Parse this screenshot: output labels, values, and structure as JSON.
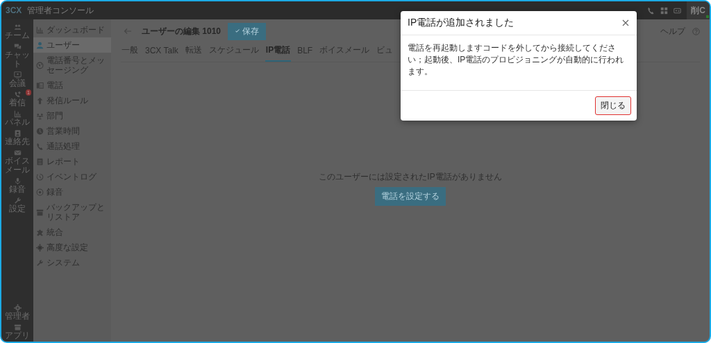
{
  "top_bar": {
    "logo": "3CX",
    "title": "管理者コンソール",
    "avatar": {
      "initials": "削C",
      "online": true
    }
  },
  "rail": {
    "items": [
      {
        "label": "チーム"
      },
      {
        "label": "チャット"
      },
      {
        "label": "会議"
      },
      {
        "label": "着信",
        "badge": "1"
      },
      {
        "label": "パネル"
      },
      {
        "label": "連絡先"
      },
      {
        "label": "ボイスメール"
      },
      {
        "label": "録音"
      },
      {
        "label": "設定"
      }
    ],
    "bottom_items": [
      {
        "label": "管理者"
      },
      {
        "label": "アプリ"
      }
    ]
  },
  "sidebar": {
    "items": [
      {
        "label": "ダッシュボード",
        "selected": false
      },
      {
        "label": "ユーザー",
        "selected": true
      },
      {
        "label": "電話番号とメッセージング",
        "selected": false
      },
      {
        "label": "電話",
        "selected": false
      },
      {
        "label": "発信ルール",
        "selected": false
      },
      {
        "label": "部門",
        "selected": false
      },
      {
        "label": "営業時間",
        "selected": false
      },
      {
        "label": "通話処理",
        "selected": false
      },
      {
        "label": "レポート",
        "selected": false
      },
      {
        "label": "イベントログ",
        "selected": false
      },
      {
        "label": "録音",
        "selected": false
      },
      {
        "label": "バックアップとリストア",
        "selected": false
      },
      {
        "label": "統合",
        "selected": false
      },
      {
        "label": "高度な設定",
        "selected": false
      },
      {
        "label": "システム",
        "selected": false
      }
    ]
  },
  "page": {
    "title": "ユーザーの編集 1010",
    "save_button": "保存",
    "help": "ヘルプ",
    "tabs": [
      {
        "label": "一般",
        "selected": false
      },
      {
        "label": "3CX Talk",
        "selected": false
      },
      {
        "label": "転送",
        "selected": false
      },
      {
        "label": "スケジュール",
        "selected": false
      },
      {
        "label": "IP電話",
        "selected": true
      },
      {
        "label": "BLF",
        "selected": false
      },
      {
        "label": "ボイスメール",
        "selected": false
      },
      {
        "label": "ビュ",
        "selected": false
      }
    ],
    "empty_message": "このユーザーには設定されたIP電話がありません",
    "add_phone_button": "電話を設定する"
  },
  "dialog": {
    "title": "IP電話が追加されました",
    "message": "電話を再起動しますコードを外してから接続してください；起動後、IP電話のプロビジョニングが自動的に行われます。",
    "close_button": "閉じる"
  }
}
